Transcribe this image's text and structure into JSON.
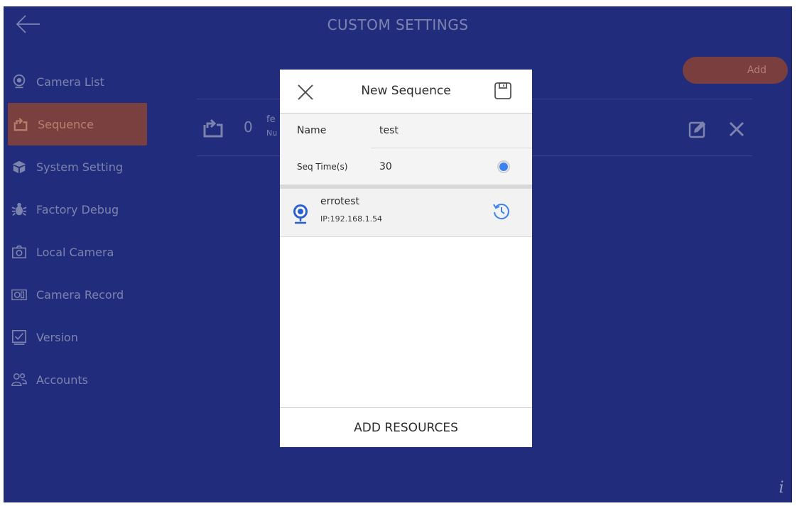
{
  "header": {
    "title": "CUSTOM SETTINGS"
  },
  "sidebar": {
    "items": [
      {
        "label": "Camera List",
        "icon": "camera-list-icon"
      },
      {
        "label": "Sequence",
        "icon": "sequence-icon",
        "active": true
      },
      {
        "label": "System Setting",
        "icon": "system-setting-icon"
      },
      {
        "label": "Factory Debug",
        "icon": "bug-icon"
      },
      {
        "label": "Local Camera",
        "icon": "local-camera-icon"
      },
      {
        "label": "Camera Record",
        "icon": "camera-record-icon"
      },
      {
        "label": "Version",
        "icon": "version-icon"
      },
      {
        "label": "Accounts",
        "icon": "accounts-icon"
      }
    ]
  },
  "toolbar": {
    "add_label": "Add"
  },
  "sequence_list": {
    "rows": [
      {
        "count": "0",
        "name_partial": "fe",
        "sub_partial": "Nu"
      }
    ]
  },
  "dialog": {
    "title": "New Sequence",
    "name_label": "Name",
    "name_value": "test",
    "seq_time_label": "Seq Time(s)",
    "seq_time_value": "30",
    "resources": [
      {
        "name": "errotest",
        "ip": "IP:192.168.1.54"
      }
    ],
    "footer_label": "ADD RESOURCES"
  },
  "info_label": "i",
  "colors": {
    "background": "#222c7c",
    "overlay_text": "#7c84ae",
    "active_item": "#7a3f3f",
    "accent_blue": "#3b82f0"
  }
}
